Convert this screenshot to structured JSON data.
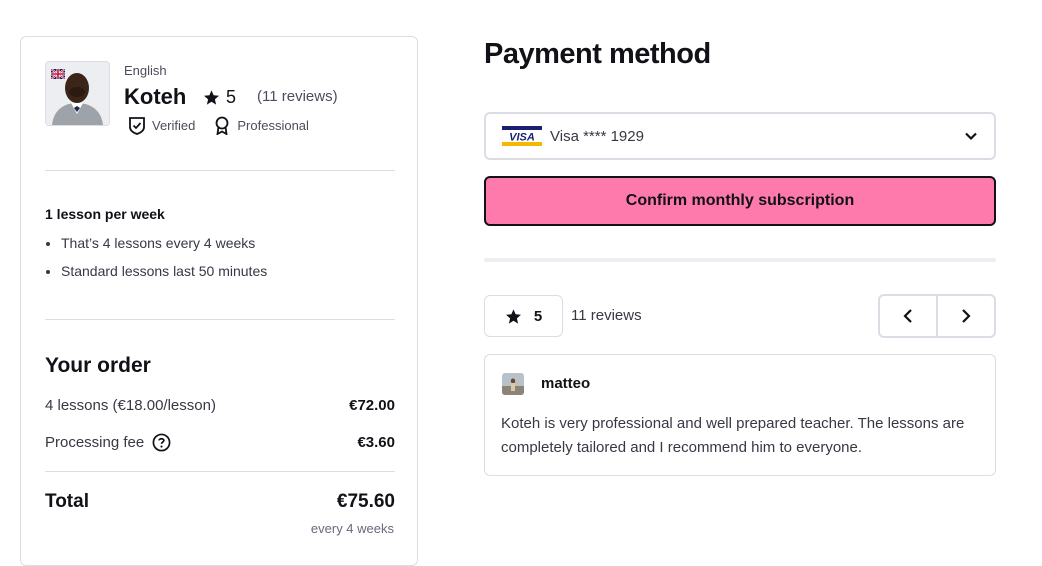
{
  "tutor": {
    "language": "English",
    "name": "Koteh",
    "rating": "5",
    "reviews": "(11 reviews)",
    "badges": [
      "Verified",
      "Professional"
    ]
  },
  "plan": {
    "title": "1 lesson per week",
    "bullets": [
      "That’s 4 lessons every 4 weeks",
      "Standard lessons last 50 minutes"
    ]
  },
  "order": {
    "title": "Your order",
    "lessons_label": "4 lessons (€18.00/lesson)",
    "lessons_amount": "€72.00",
    "fee_label": "Processing fee",
    "fee_amount": "€3.60",
    "total_label": "Total",
    "total_amount": "€75.60",
    "frequency": "every 4 weeks"
  },
  "payment": {
    "title": "Payment method",
    "card_brand_logo": "VISA",
    "card_label": "Visa **** 1929",
    "confirm_label": "Confirm monthly subscription"
  },
  "reviews_section": {
    "rating": "5",
    "count_label": "11 reviews",
    "items": [
      {
        "author": "matteo",
        "text": "Koteh is very professional and well prepared teacher. The lessons are completely tailored and I recommend him to everyone."
      }
    ]
  },
  "colors": {
    "accent_pink": "#ff7aac",
    "border": "#dcdce5",
    "text": "#121117"
  },
  "icons": [
    "uk-flag-icon",
    "star-icon",
    "verified-shield-icon",
    "professional-badge-icon",
    "help-circle-icon",
    "visa-logo-icon",
    "chevron-down-icon",
    "chevron-left-icon",
    "chevron-right-icon"
  ]
}
